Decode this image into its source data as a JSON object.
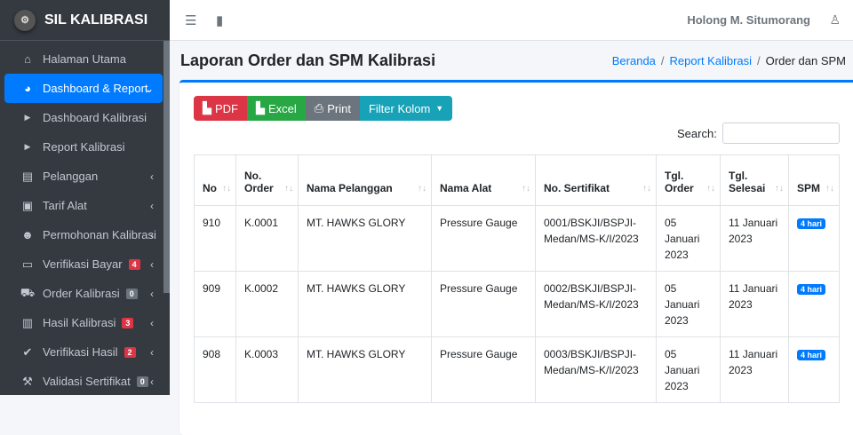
{
  "brand": "SIL KALIBRASI",
  "sidebar": {
    "items": [
      {
        "label": "Halaman Utama",
        "icon": "home-icon",
        "glyph": "⌂"
      },
      {
        "label": "Dashboard & Report",
        "icon": "chart-pie-icon",
        "glyph": "◕",
        "active": true
      },
      {
        "label": "Dashboard Kalibrasi",
        "icon": "caret-right-icon",
        "glyph": "▶",
        "sub": true
      },
      {
        "label": "Report Kalibrasi",
        "icon": "caret-right-icon",
        "glyph": "▶",
        "sub": true
      },
      {
        "label": "Pelanggan",
        "icon": "id-card-icon",
        "glyph": "▤"
      },
      {
        "label": "Tarif Alat",
        "icon": "money-icon",
        "glyph": "▣"
      },
      {
        "label": "Permohonan Kalibrasi",
        "icon": "user-edit-icon",
        "glyph": "☻"
      },
      {
        "label": "Verifikasi Bayar",
        "icon": "credit-card-icon",
        "glyph": "▭",
        "badge": "4",
        "badge_type": "danger"
      },
      {
        "label": "Order Kalibrasi",
        "icon": "cart-icon",
        "glyph": "⛟",
        "badge": "0",
        "badge_type": "secondary"
      },
      {
        "label": "Hasil Kalibrasi",
        "icon": "clipboard-icon",
        "glyph": "▥",
        "badge": "3",
        "badge_type": "danger"
      },
      {
        "label": "Verifikasi Hasil",
        "icon": "check-circle-icon",
        "glyph": "✔",
        "badge": "2",
        "badge_type": "danger"
      },
      {
        "label": "Validasi Sertifikat",
        "icon": "gavel-icon",
        "glyph": "⚒",
        "badge": "0",
        "badge_type": "secondary"
      }
    ]
  },
  "header": {
    "user": "Holong M. Situmorang"
  },
  "page": {
    "title": "Laporan Order dan SPM Kalibrasi",
    "breadcrumb": [
      "Beranda",
      "Report Kalibrasi",
      "Order dan SPM"
    ]
  },
  "toolbar": {
    "pdf": "PDF",
    "excel": "Excel",
    "print": "Print",
    "filter": "Filter Kolom",
    "search_label": "Search:",
    "search_value": ""
  },
  "table": {
    "headers": [
      "No",
      "No. Order",
      "Nama Pelanggan",
      "Nama Alat",
      "No. Sertifikat",
      "Tgl. Order",
      "Tgl. Selesai",
      "SPM"
    ],
    "rows": [
      [
        "910",
        "K.0001",
        "MT. HAWKS GLORY",
        "Pressure Gauge",
        "0001/BSKJI/BSPJI-Medan/MS-K/I/2023",
        "05 Januari 2023",
        "11 Januari 2023",
        "4 hari"
      ],
      [
        "909",
        "K.0002",
        "MT. HAWKS GLORY",
        "Pressure Gauge",
        "0002/BSKJI/BSPJI-Medan/MS-K/I/2023",
        "05 Januari 2023",
        "11 Januari 2023",
        "4 hari"
      ],
      [
        "908",
        "K.0003",
        "MT. HAWKS GLORY",
        "Pressure Gauge",
        "0003/BSKJI/BSPJI-Medan/MS-K/I/2023",
        "05 Januari 2023",
        "11 Januari 2023",
        "4 hari"
      ]
    ]
  }
}
